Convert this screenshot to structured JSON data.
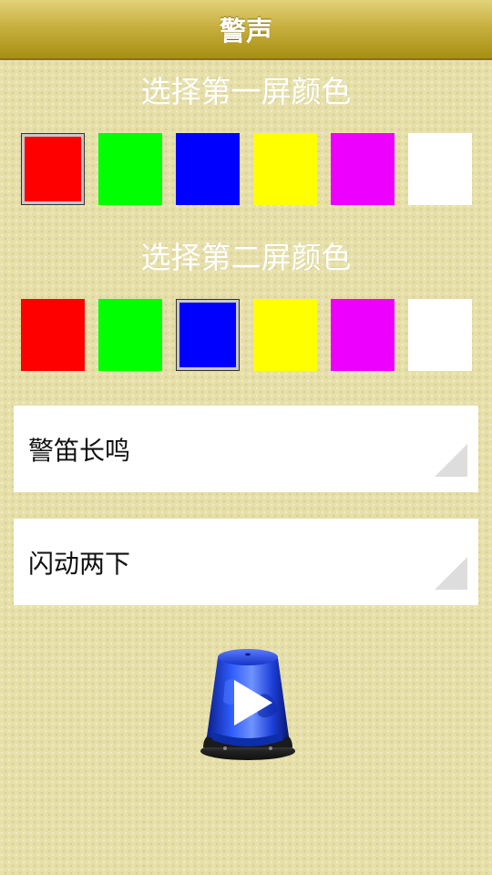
{
  "header": {
    "title": "警声"
  },
  "screen1": {
    "label": "选择第一屏颜色",
    "colors": [
      "#ff0000",
      "#00ff00",
      "#0000ff",
      "#ffff00",
      "#ee00ff",
      "#ffffff"
    ],
    "selected_index": 0
  },
  "screen2": {
    "label": "选择第二屏颜色",
    "colors": [
      "#ff0000",
      "#00ff00",
      "#0000ff",
      "#ffff00",
      "#ee00ff",
      "#ffffff"
    ],
    "selected_index": 2
  },
  "sound_select": {
    "value": "警笛长鸣"
  },
  "flash_select": {
    "value": "闪动两下"
  },
  "play_button": {
    "icon": "siren-play-icon"
  }
}
